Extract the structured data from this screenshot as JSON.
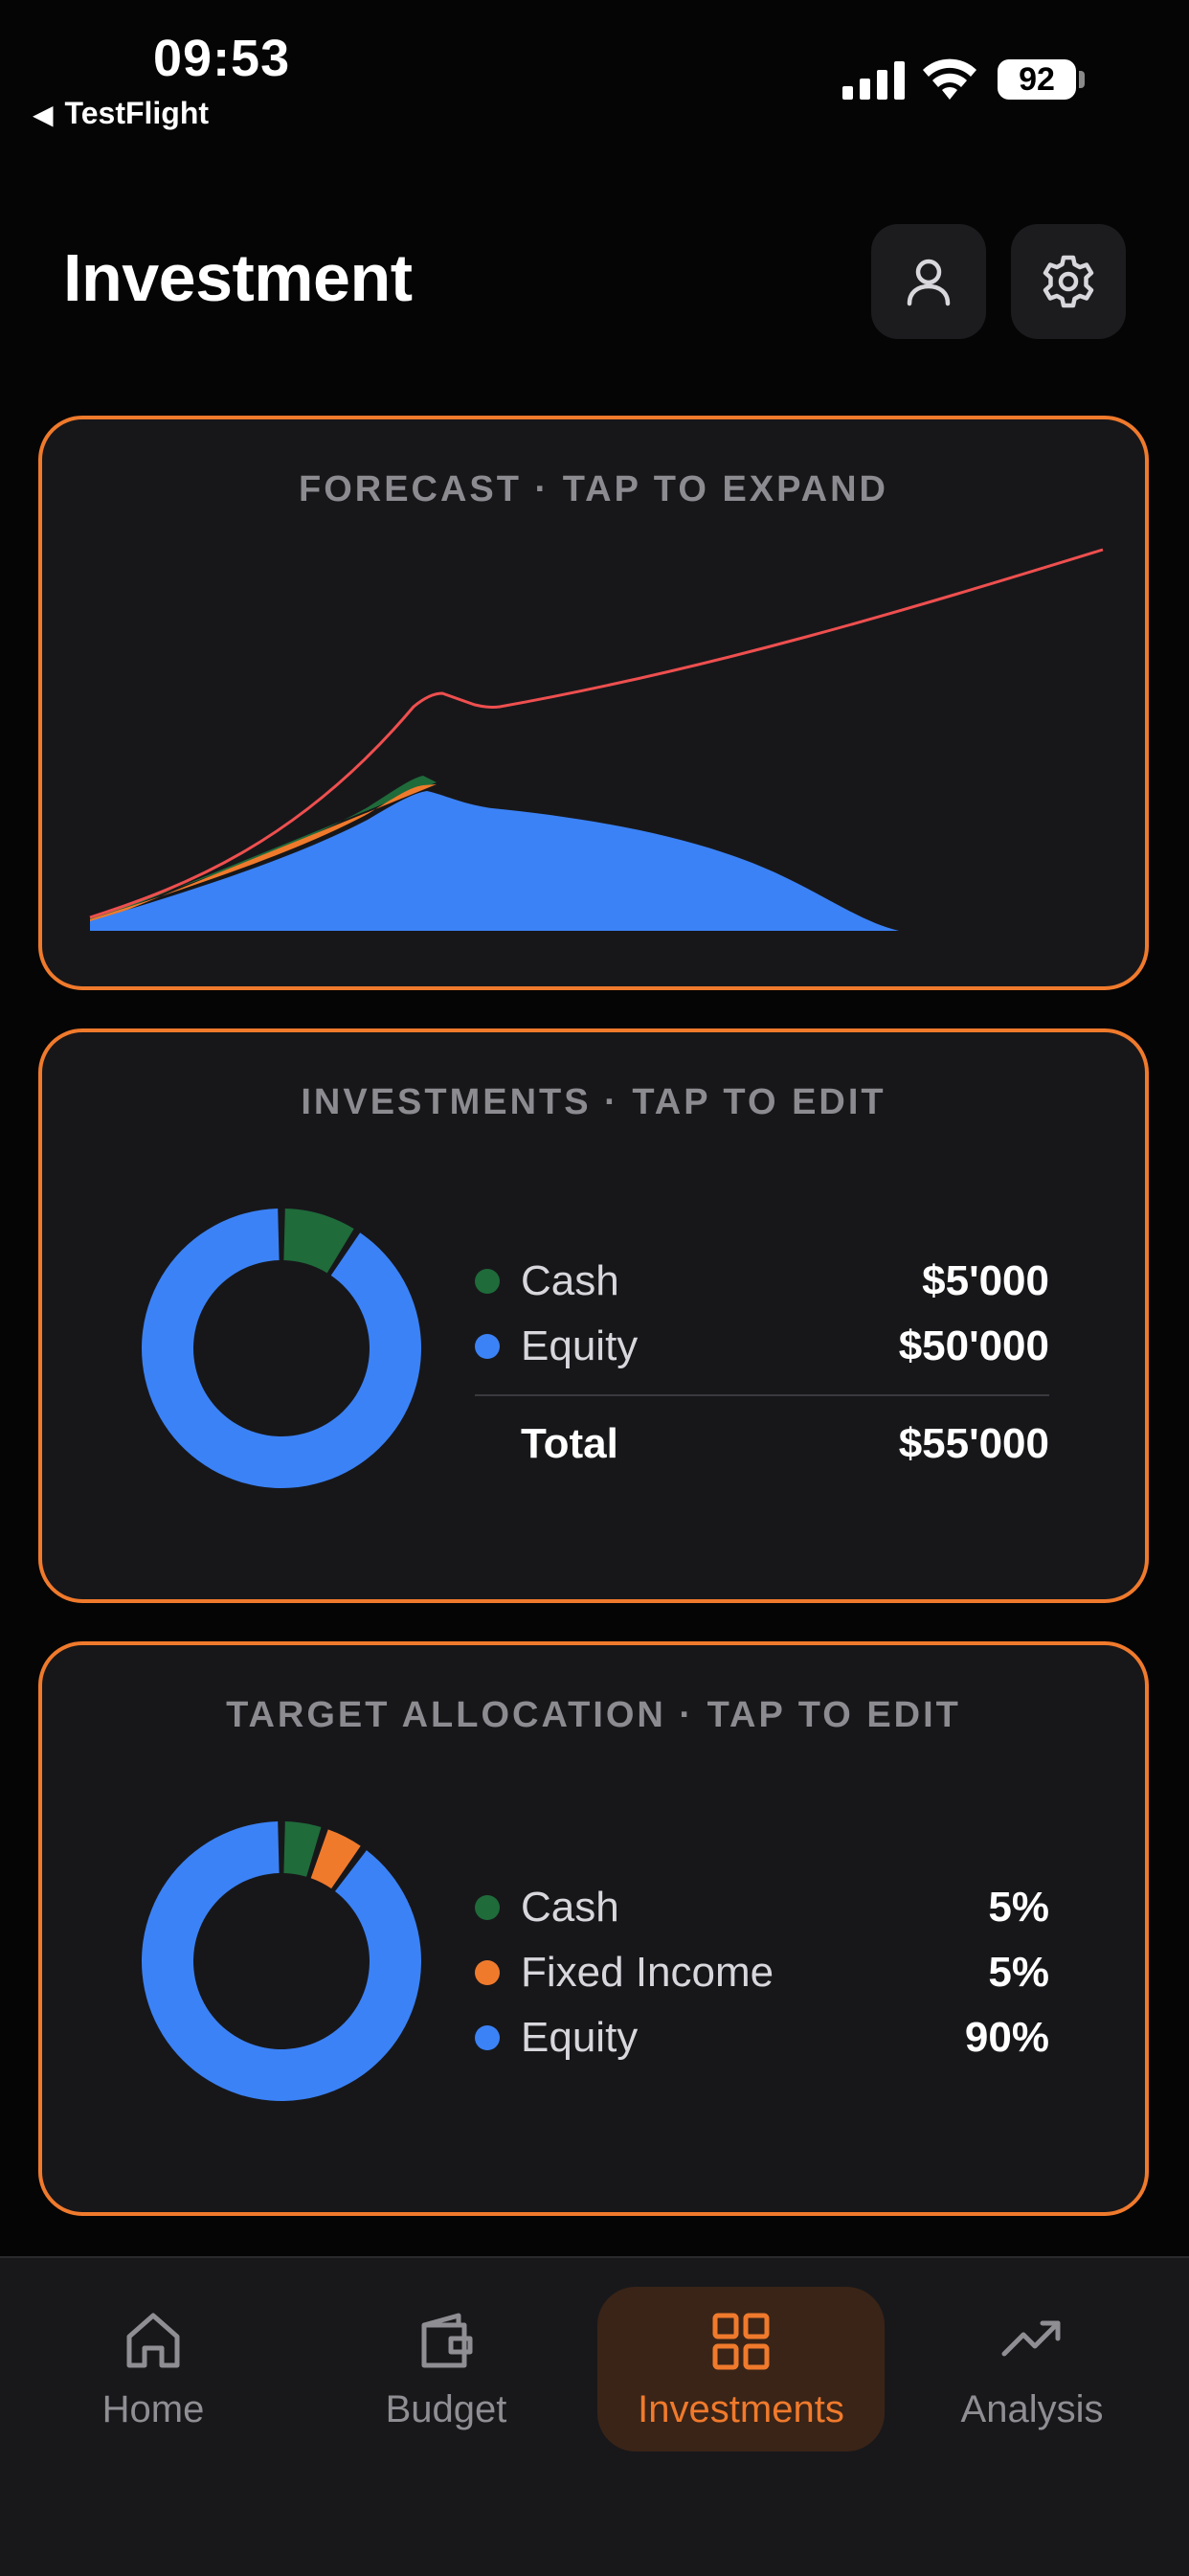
{
  "status": {
    "time": "09:53",
    "back_label": "TestFlight",
    "battery": "92"
  },
  "header": {
    "title": "Investment",
    "icons": [
      "person-icon",
      "gear-icon"
    ]
  },
  "forecast": {
    "title": "FORECAST · TAP TO EXPAND"
  },
  "investments": {
    "title": "INVESTMENTS · TAP TO EDIT",
    "items": [
      {
        "label": "Cash",
        "value": "$5'000",
        "color": "#1f6b3a"
      },
      {
        "label": "Equity",
        "value": "$50'000",
        "color": "#3b82f6"
      }
    ],
    "total_label": "Total",
    "total_value": "$55'000",
    "shares": [
      5000,
      50000
    ]
  },
  "target": {
    "title": "TARGET ALLOCATION · TAP TO EDIT",
    "items": [
      {
        "label": "Cash",
        "value": "5%",
        "color": "#1f6b3a"
      },
      {
        "label": "Fixed Income",
        "value": "5%",
        "color": "#f07a2c"
      },
      {
        "label": "Equity",
        "value": "90%",
        "color": "#3b82f6"
      }
    ],
    "shares": [
      5,
      5,
      90
    ]
  },
  "tabs": [
    {
      "label": "Home",
      "icon": "home-icon"
    },
    {
      "label": "Budget",
      "icon": "wallet-icon"
    },
    {
      "label": "Investments",
      "icon": "grid-icon",
      "active": true
    },
    {
      "label": "Analysis",
      "icon": "trend-icon"
    }
  ],
  "colors": {
    "accent": "#f07a2c",
    "equity": "#3b82f6",
    "cash": "#1f6b3a",
    "forecast_line": "#ef4f4f"
  }
}
